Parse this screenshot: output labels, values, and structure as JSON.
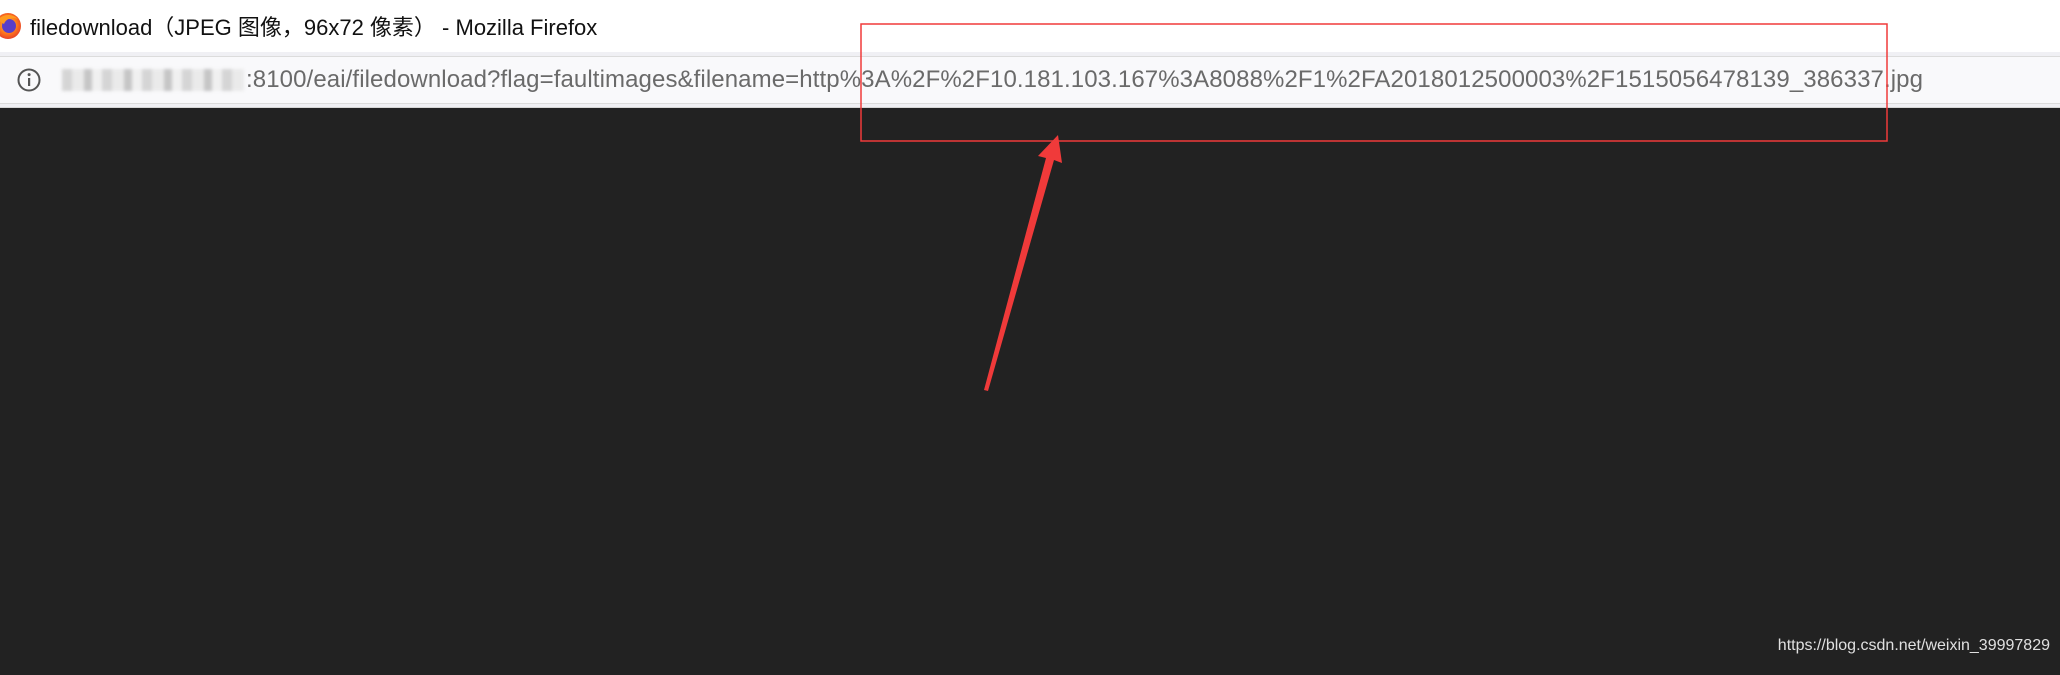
{
  "window": {
    "title": "filedownload（JPEG 图像，96x72 像素） - Mozilla Firefox"
  },
  "urlbar": {
    "visible_url": ":8100/eai/filedownload?flag=faultimages&filename=http%3A%2F%2F10.181.103.167%3A8088%2F1%2FA2018012500003%2F1515056478139_386337.jpg",
    "host_obscured": true
  },
  "content": {
    "background_color": "#222222"
  },
  "annotation": {
    "color": "#f03a3a",
    "shape": "rectangle-with-arrow"
  },
  "watermark": {
    "text": "https://blog.csdn.net/weixin_39997829"
  },
  "icons": {
    "browser_logo": "firefox-logo-icon",
    "site_info": "info-icon"
  }
}
